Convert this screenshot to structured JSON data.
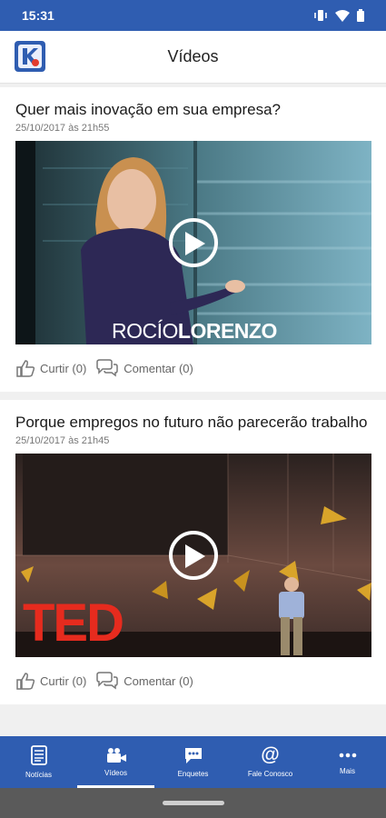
{
  "status_bar": {
    "time": "15:31"
  },
  "header": {
    "title": "Vídeos"
  },
  "videos": [
    {
      "title": "Quer mais inovação em sua empresa?",
      "date": "25/10/2017 às 21h55",
      "overlay_text_light": "ROCÍO",
      "overlay_text_bold": "LORENZO",
      "like_label": "Curtir (0)",
      "comment_label": "Comentar (0)"
    },
    {
      "title": "Porque empregos no futuro não parecerão trabalho",
      "date": "25/10/2017 às 21h45",
      "overlay_text": "TED",
      "like_label": "Curtir (0)",
      "comment_label": "Comentar (0)"
    }
  ],
  "bottom_nav": [
    {
      "label": "Notícias",
      "icon": "newspaper-icon"
    },
    {
      "label": "Vídeos",
      "icon": "video-camera-icon",
      "active": true
    },
    {
      "label": "Enquetes",
      "icon": "chat-icon"
    },
    {
      "label": "Fale Conosco",
      "icon": "at-icon"
    },
    {
      "label": "Mais",
      "icon": "more-icon"
    }
  ],
  "colors": {
    "primary": "#2f5db1",
    "ted_red": "#e62b1e"
  }
}
